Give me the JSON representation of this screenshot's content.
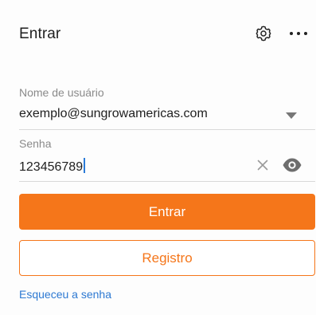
{
  "header": {
    "title": "Entrar",
    "settings_icon": "gear-icon",
    "more_icon": "more-horizontal-icon"
  },
  "form": {
    "username": {
      "label": "Nome de usuário",
      "value": "exemplo@sungrowamericas.com",
      "dropdown_icon": "triangle-down-icon"
    },
    "password": {
      "label": "Senha",
      "value": "123456789",
      "clear_icon": "close-icon",
      "visibility_icon": "eye-icon"
    }
  },
  "actions": {
    "login_label": "Entrar",
    "register_label": "Registro",
    "forgot_label": "Esqueceu a senha"
  },
  "colors": {
    "accent": "#f5761a",
    "link": "#2d79d2",
    "caret": "#2b7bd8"
  }
}
